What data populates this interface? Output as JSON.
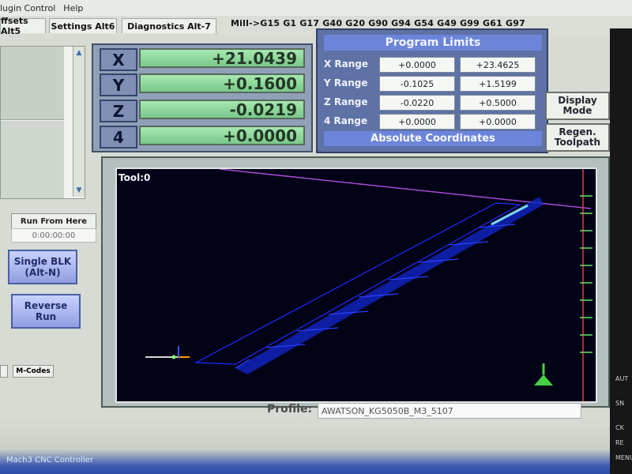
{
  "menu": {
    "items": [
      "lugin Control",
      "Help"
    ]
  },
  "tabs": {
    "offsets": "ffsets Alt5",
    "settings": "Settings Alt6",
    "diagnostics": "Diagnostics Alt-7"
  },
  "gcodes": "Mill->G15  G1 G17 G40 G20 G90 G94 G54 G49 G99 G61 G97",
  "left": {
    "run_from_here": "Run From Here",
    "timer": "0:00:00:00",
    "single_blk": "Single BLK\n(Alt-N)",
    "reverse_run": "Reverse\nRun",
    "m_codes": "M-Codes"
  },
  "dro": {
    "axes": [
      {
        "label": "X",
        "value": "+21.0439"
      },
      {
        "label": "Y",
        "value": "+0.1600"
      },
      {
        "label": "Z",
        "value": "-0.0219"
      },
      {
        "label": "4",
        "value": "+0.0000"
      }
    ]
  },
  "limits": {
    "title": "Program Limits",
    "rows": [
      {
        "label": "X Range",
        "min": "+0.0000",
        "max": "+23.4625"
      },
      {
        "label": "Y Range",
        "min": "-0.1025",
        "max": "+1.5199"
      },
      {
        "label": "Z Range",
        "min": "-0.0220",
        "max": "+0.5000"
      },
      {
        "label": "4 Range",
        "min": "+0.0000",
        "max": "+0.0000"
      }
    ],
    "absolute_coordinates": "Absolute Coordinates"
  },
  "buttons": {
    "display_mode": "Display\nMode",
    "regen_toolpath": "Regen.\nToolpath"
  },
  "toolpath": {
    "tool_label": "Tool:0"
  },
  "profile": {
    "label": "Profile:",
    "value": "AWATSON_KG5050B_M3_5107"
  },
  "taskbar": {
    "app_title": "Mach3 CNC Controller"
  },
  "right_strip": {
    "labels": [
      "AUT",
      "SN",
      "CK",
      "RE",
      "MENU"
    ]
  }
}
